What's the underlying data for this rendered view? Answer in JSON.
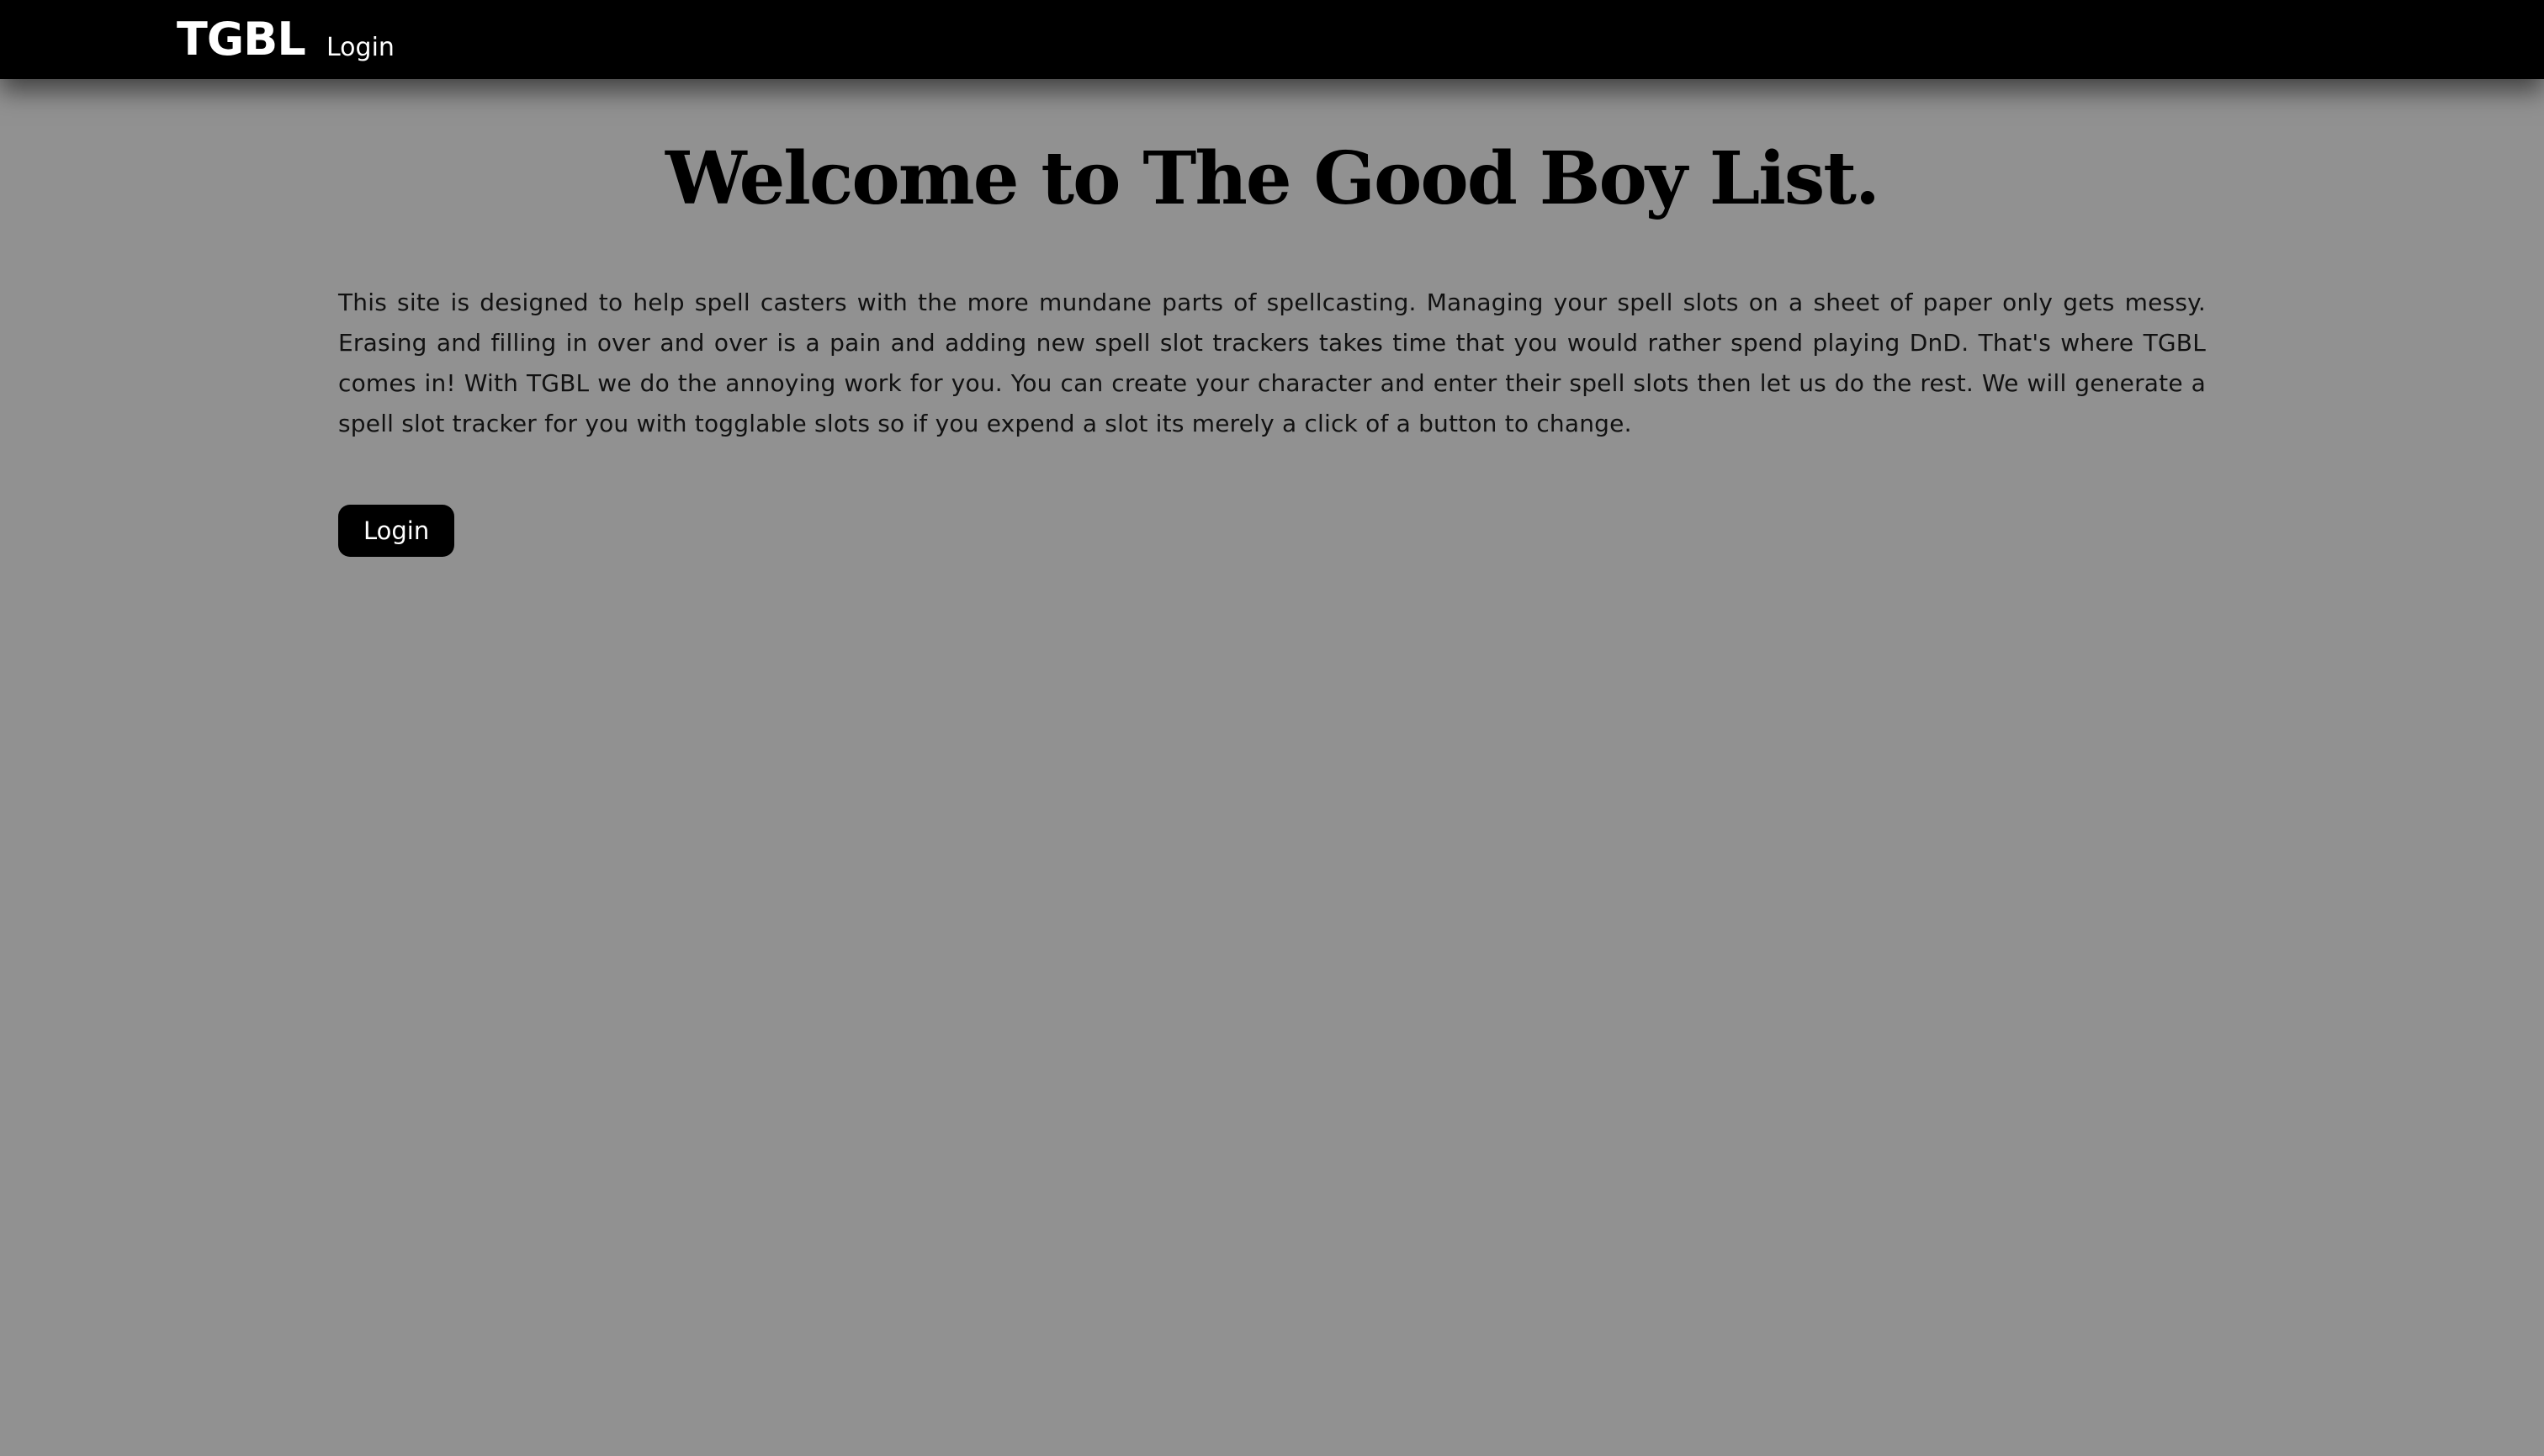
{
  "nav": {
    "brand": "TGBL",
    "links": [
      {
        "label": "Login"
      }
    ]
  },
  "main": {
    "title": "Welcome to The Good Boy List.",
    "intro": "This site is designed to help spell casters with the more mundane parts of spellcasting. Managing your spell slots on a sheet of paper only gets messy. Erasing and filling in over and over is a pain and adding new spell slot trackers takes time that you would rather spend playing DnD. That's where TGBL comes in! With TGBL we do the annoying work for you. You can create your character and enter their spell slots then let us do the rest. We will generate a spell slot tracker for you with togglable slots so if you expend a slot its merely a click of a button to change.",
    "login_button": "Login"
  },
  "colors": {
    "background": "#919191",
    "navbar": "#000000",
    "button": "#000000",
    "text": "#111111"
  }
}
